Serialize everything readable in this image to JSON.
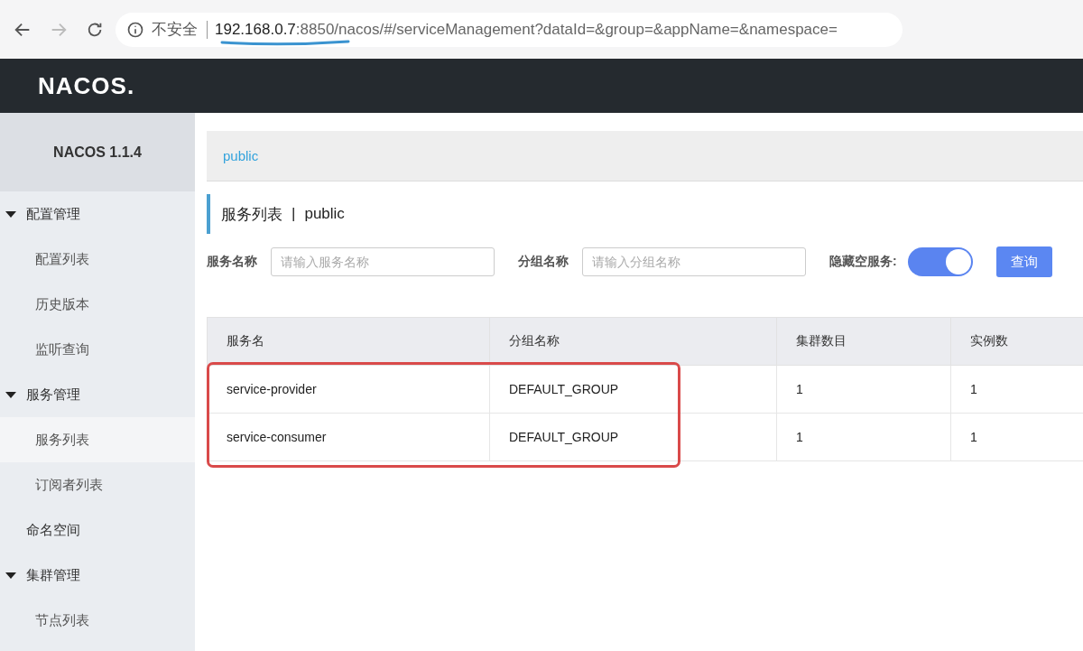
{
  "browser": {
    "back_disabled": false,
    "forward_disabled": true,
    "security_label": "不安全",
    "url_host": "192.168.0.7",
    "url_rest": ":8850/nacos/#/serviceManagement?dataId=&group=&appName=&namespace="
  },
  "header": {
    "logo": "NACOS."
  },
  "sidebar": {
    "title": "NACOS 1.1.4",
    "items": [
      {
        "label": "配置管理",
        "expanded": true,
        "children": [
          {
            "label": "配置列表",
            "selected": false
          },
          {
            "label": "历史版本",
            "selected": false
          },
          {
            "label": "监听查询",
            "selected": false
          }
        ]
      },
      {
        "label": "服务管理",
        "expanded": true,
        "children": [
          {
            "label": "服务列表",
            "selected": true
          },
          {
            "label": "订阅者列表",
            "selected": false
          }
        ]
      },
      {
        "label": "命名空间"
      },
      {
        "label": "集群管理",
        "expanded": true,
        "children": [
          {
            "label": "节点列表",
            "selected": false
          }
        ]
      }
    ]
  },
  "namespace_bar": {
    "namespaces": [
      {
        "label": "public",
        "selected": true
      }
    ]
  },
  "page_title": {
    "title": "服务列表",
    "separator": "|",
    "namespace": "public"
  },
  "filters": {
    "service_label": "服务名称",
    "service_placeholder": "请输入服务名称",
    "group_label": "分组名称",
    "group_placeholder": "请输入分组名称",
    "hide_empty_label": "隐藏空服务:",
    "hide_empty_on": true,
    "query_button": "查询"
  },
  "table": {
    "columns": [
      "服务名",
      "分组名称",
      "集群数目",
      "实例数"
    ],
    "rows": [
      [
        "service-provider",
        "DEFAULT_GROUP",
        "1",
        "1"
      ],
      [
        "service-consumer",
        "DEFAULT_GROUP",
        "1",
        "1"
      ]
    ]
  }
}
